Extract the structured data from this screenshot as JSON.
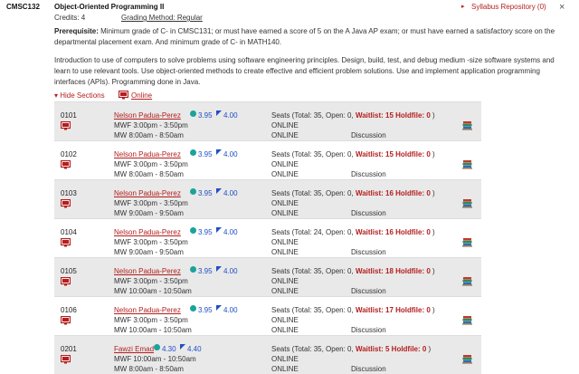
{
  "course": {
    "id": "CMSC132",
    "title": "Object-Oriented Programming II",
    "credits": "Credits: 4",
    "grading": "Grading Method: Regular",
    "syllabus": "Syllabus Repository (0)",
    "prereq_label": "Prerequisite:",
    "prereq_text": " Minimum grade of C- in CMSC131; or must have earned a score of 5 on the A Java AP exam; or must have earned a satisfactory score on the departmental placement exam. And minimum grade of C- in MATH140.",
    "description": "Introduction to use of computers to solve problems using software engineering principles. Design, build, test, and debug medium -size software systems and learn to use relevant tools. Use object-oriented methods to create effective and efficient problem solutions. Use and implement application programming interfaces (APIs). Programming done in Java."
  },
  "controls": {
    "hide_sections": "▾ Hide Sections",
    "online": "Online",
    "close": "×"
  },
  "sections": [
    {
      "id": "0101",
      "instructor": "Nelson Padua-Perez",
      "rating1": "3.95",
      "rating2": "4.00",
      "time1": "MWF 3:00pm - 3:50pm",
      "time2": "MW 8:00am - 8:50am",
      "seats": "Seats (Total: 35, Open: 0, ",
      "waitlist": "Waitlist: 15 Holdfile: 0",
      "seats_end": " )",
      "loc1": "ONLINE",
      "loc2": "ONLINE",
      "disc": "Discussion"
    },
    {
      "id": "0102",
      "instructor": "Nelson Padua-Perez",
      "rating1": "3.95",
      "rating2": "4.00",
      "time1": "MWF 3:00pm - 3:50pm",
      "time2": "MW 8:00am - 8:50am",
      "seats": "Seats (Total: 35, Open: 0, ",
      "waitlist": "Waitlist: 15 Holdfile: 0",
      "seats_end": " )",
      "loc1": "ONLINE",
      "loc2": "ONLINE",
      "disc": "Discussion"
    },
    {
      "id": "0103",
      "instructor": "Nelson Padua-Perez",
      "rating1": "3.95",
      "rating2": "4.00",
      "time1": "MWF 3:00pm - 3:50pm",
      "time2": "MW 9:00am - 9:50am",
      "seats": "Seats (Total: 35, Open: 0, ",
      "waitlist": "Waitlist: 16 Holdfile: 0",
      "seats_end": " )",
      "loc1": "ONLINE",
      "loc2": "ONLINE",
      "disc": "Discussion"
    },
    {
      "id": "0104",
      "instructor": "Nelson Padua-Perez",
      "rating1": "3.95",
      "rating2": "4.00",
      "time1": "MWF 3:00pm - 3:50pm",
      "time2": "MW 9:00am - 9:50am",
      "seats": "Seats (Total: 24, Open: 0, ",
      "waitlist": "Waitlist: 16 Holdfile: 0",
      "seats_end": " )",
      "loc1": "ONLINE",
      "loc2": "ONLINE",
      "disc": "Discussion"
    },
    {
      "id": "0105",
      "instructor": "Nelson Padua-Perez",
      "rating1": "3.95",
      "rating2": "4.00",
      "time1": "MWF 3:00pm - 3:50pm",
      "time2": "MW 10:00am - 10:50am",
      "seats": "Seats (Total: 35, Open: 0, ",
      "waitlist": "Waitlist: 18 Holdfile: 0",
      "seats_end": " )",
      "loc1": "ONLINE",
      "loc2": "ONLINE",
      "disc": "Discussion"
    },
    {
      "id": "0106",
      "instructor": "Nelson Padua-Perez",
      "rating1": "3.95",
      "rating2": "4.00",
      "time1": "MWF 3:00pm - 3:50pm",
      "time2": "MW 10:00am - 10:50am",
      "seats": "Seats (Total: 35, Open: 0, ",
      "waitlist": "Waitlist: 17 Holdfile: 0",
      "seats_end": " )",
      "loc1": "ONLINE",
      "loc2": "ONLINE",
      "disc": "Discussion"
    },
    {
      "id": "0201",
      "instructor": "Fawzi Emad",
      "rating1": "4.30",
      "rating2": "4.40",
      "time1": "MWF 10:00am - 10:50am",
      "time2": "MW 8:00am - 8:50am",
      "seats": "Seats (Total: 35, Open: 0, ",
      "waitlist": "Waitlist: 5 Holdfile: 0",
      "seats_end": " )",
      "loc1": "ONLINE",
      "loc2": "ONLINE",
      "disc": "Discussion"
    }
  ],
  "colors": {
    "accent_red": "#b41e1e",
    "link_blue": "#1f4fc7",
    "rating_teal": "#1aa39a",
    "row_shade": "#e9e9e9"
  },
  "icons": {
    "monitor": "monitor-icon",
    "books": "books-icon",
    "rating_dot": "rating-dot-icon",
    "flag": "flag-icon",
    "arrow": "arrow-right-icon",
    "close": "close-icon"
  }
}
